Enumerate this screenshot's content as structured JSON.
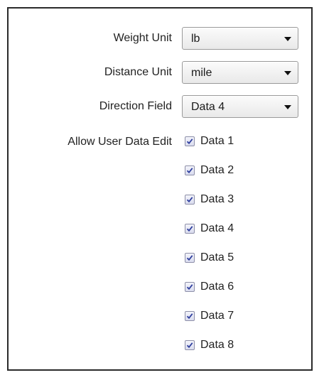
{
  "settings": {
    "weight_unit": {
      "label": "Weight Unit",
      "value": "lb"
    },
    "distance_unit": {
      "label": "Distance Unit",
      "value": "mile"
    },
    "direction_field": {
      "label": "Direction Field",
      "value": "Data 4"
    },
    "allow_user_data_edit": {
      "label": "Allow User Data Edit",
      "items": [
        {
          "label": "Data 1",
          "checked": true
        },
        {
          "label": "Data 2",
          "checked": true
        },
        {
          "label": "Data 3",
          "checked": true
        },
        {
          "label": "Data 4",
          "checked": true
        },
        {
          "label": "Data 5",
          "checked": true
        },
        {
          "label": "Data 6",
          "checked": true
        },
        {
          "label": "Data 7",
          "checked": true
        },
        {
          "label": "Data 8",
          "checked": true
        }
      ]
    }
  },
  "colors": {
    "checkmark": "#2f3f9e",
    "border": "#2a2a2a"
  },
  "icons": {
    "dropdown": "chevron-down-icon",
    "checkbox_mark": "checkmark-icon"
  }
}
